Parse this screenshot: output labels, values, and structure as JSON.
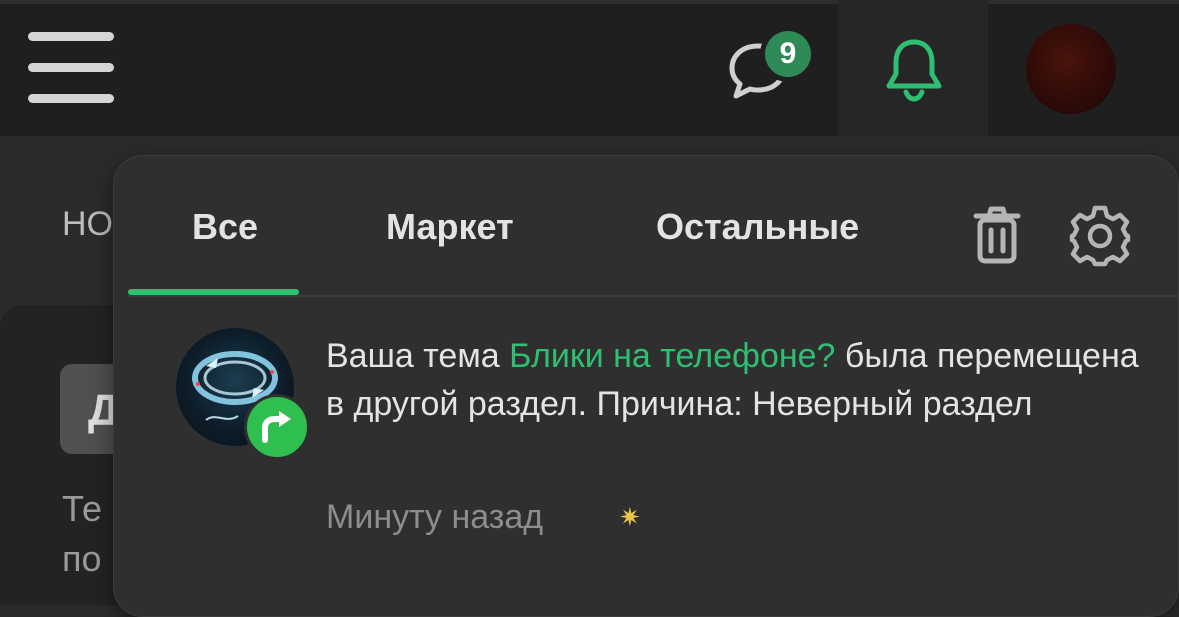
{
  "header": {
    "messages_badge": "9",
    "menu_icon": "hamburger-menu-icon",
    "messages_icon": "chat-bubble-icon",
    "notifications_icon": "bell-icon",
    "accent_color": "#2fbf71"
  },
  "background": {
    "nav_fragment": "НО",
    "card_letter": "Д",
    "text_line1": "Те",
    "text_line2": "по"
  },
  "popup": {
    "tabs": [
      {
        "label": "Все",
        "active": true
      },
      {
        "label": "Маркет",
        "active": false
      },
      {
        "label": "Остальные",
        "active": false
      }
    ],
    "actions": {
      "delete_icon": "trash-icon",
      "settings_icon": "gear-icon"
    },
    "notifications": [
      {
        "text_before": "Ваша тема ",
        "link": "Блики на телефоне?",
        "text_after": " была перемещена в другой раздел. Причина: Неверный раздел",
        "time": "Минуту назад",
        "badge_icon": "move-arrow-icon",
        "time_icon": "sparkle-icon"
      }
    ]
  }
}
